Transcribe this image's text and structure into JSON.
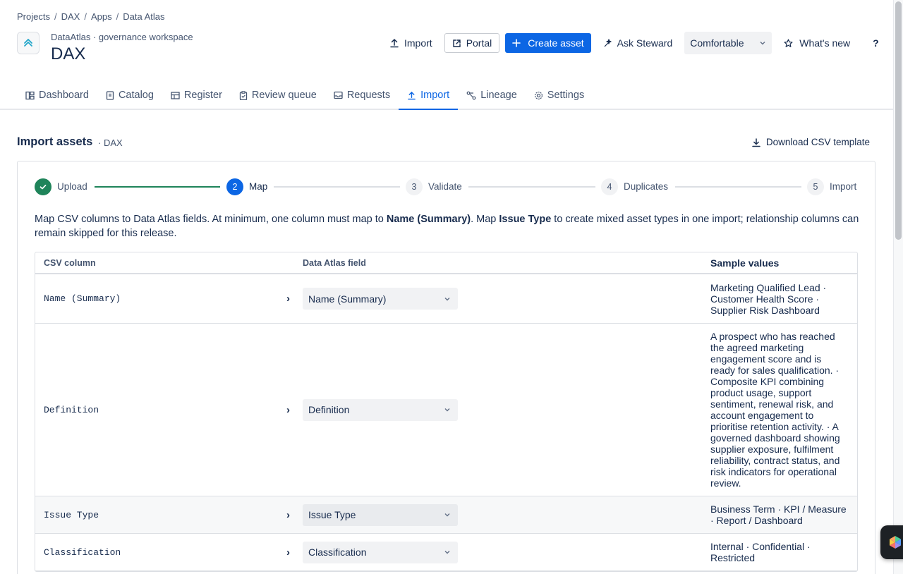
{
  "breadcrumb": [
    "Projects",
    "DAX",
    "Apps",
    "Data Atlas"
  ],
  "header": {
    "subtitle": "DataAtlas · governance workspace",
    "title": "DAX"
  },
  "actions": {
    "import": "Import",
    "portal": "Portal",
    "create_asset": "Create asset",
    "ask_steward": "Ask Steward",
    "density": "Comfortable",
    "whats_new": "What's new",
    "help": "?"
  },
  "tabs": [
    {
      "label": "Dashboard",
      "icon": "dashboard-icon"
    },
    {
      "label": "Catalog",
      "icon": "catalog-icon"
    },
    {
      "label": "Register",
      "icon": "register-icon"
    },
    {
      "label": "Review queue",
      "icon": "clipboard-icon"
    },
    {
      "label": "Requests",
      "icon": "inbox-icon"
    },
    {
      "label": "Import",
      "icon": "upload-icon",
      "active": true
    },
    {
      "label": "Lineage",
      "icon": "lineage-icon"
    },
    {
      "label": "Settings",
      "icon": "gear-icon"
    }
  ],
  "section": {
    "title": "Import assets",
    "sub": "· DAX",
    "download": "Download CSV template"
  },
  "steps": [
    {
      "num": "",
      "label": "Upload",
      "state": "done"
    },
    {
      "num": "2",
      "label": "Map",
      "state": "current"
    },
    {
      "num": "3",
      "label": "Validate",
      "state": "pending"
    },
    {
      "num": "4",
      "label": "Duplicates",
      "state": "pending"
    },
    {
      "num": "5",
      "label": "Import",
      "state": "pending"
    }
  ],
  "intro": {
    "p1": "Map CSV columns to Data Atlas fields. At minimum, one column must map to ",
    "b1": "Name (Summary)",
    "p2": ". Map ",
    "b2": "Issue Type",
    "p3": " to create mixed asset types in one import; relationship columns can remain skipped for this release."
  },
  "table": {
    "headers": [
      "CSV column",
      "Data Atlas field",
      "Sample values"
    ],
    "rows": [
      {
        "column": "Name (Summary)",
        "field": "Name (Summary)",
        "samples": "Marketing Qualified Lead · Customer Health Score · Supplier Risk Dashboard"
      },
      {
        "column": "Definition",
        "field": "Definition",
        "samples": "A prospect who has reached the agreed marketing engagement score and is ready for sales qualification. · Composite KPI combining product usage, support sentiment, renewal risk, and account engagement to prioritise retention activity. · A governed dashboard showing supplier exposure, fulfilment reliability, contract status, and risk indicators for operational review."
      },
      {
        "column": "Issue Type",
        "field": "Issue Type",
        "samples": "Business Term · KPI / Measure · Report / Dashboard"
      },
      {
        "column": "Classification",
        "field": "Classification",
        "samples": "Internal · Confidential · Restricted"
      }
    ]
  },
  "colors": {
    "primary": "#0c66e4",
    "success": "#1f845a",
    "text": "#172b4d"
  }
}
